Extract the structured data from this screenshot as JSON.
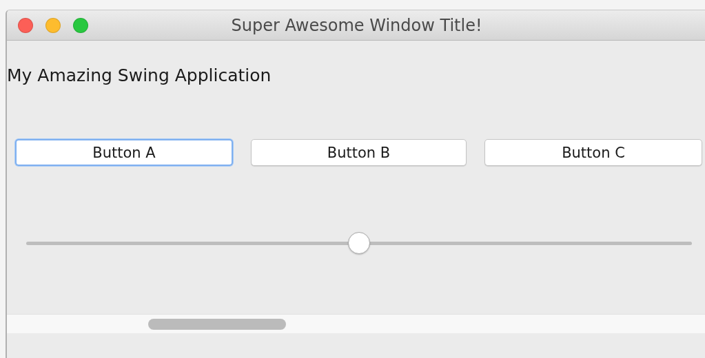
{
  "window": {
    "title": "Super Awesome Window Title!"
  },
  "label": "My Amazing Swing Application",
  "buttons": [
    {
      "label": "Button A",
      "focused": true
    },
    {
      "label": "Button B",
      "focused": false
    },
    {
      "label": "Button C",
      "focused": false
    }
  ],
  "slider": {
    "level": 0.5
  }
}
